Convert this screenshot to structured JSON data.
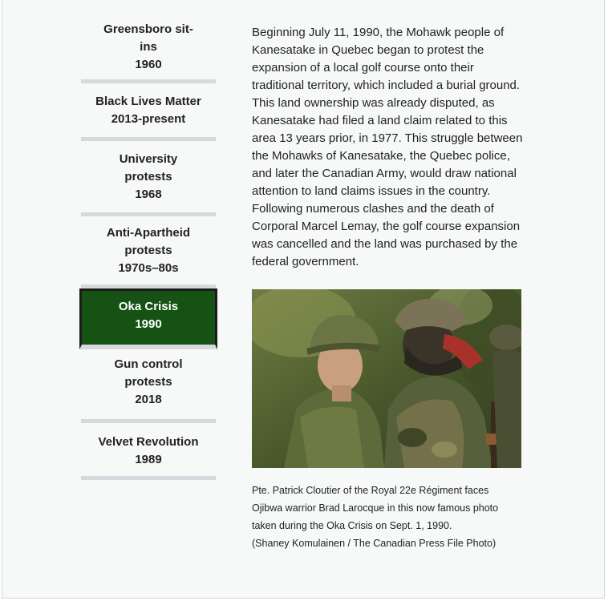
{
  "tabs": [
    {
      "title": "Greensboro sit-ins",
      "year": "1960",
      "active": false
    },
    {
      "title": "Black Lives Matter",
      "year": "2013-present",
      "active": false
    },
    {
      "title": "University protests",
      "year": "1968",
      "active": false
    },
    {
      "title": "Anti-Apartheid protests",
      "year": "1970s–80s",
      "active": false
    },
    {
      "title": "Oka Crisis",
      "year": "1990",
      "active": true
    },
    {
      "title": "Gun control protests",
      "year": "2018",
      "active": false
    },
    {
      "title": "Velvet Revolution",
      "year": "1989",
      "active": false
    }
  ],
  "content": {
    "paragraph": "Beginning July 11, 1990, the Mohawk people of Kanesatake in Quebec began to protest the expansion of a local golf course onto their traditional territory, which included a burial ground. This land ownership was already disputed, as Kanesatake had filed a land claim related to this area 13 years prior, in 1977. This struggle between the Mohawks of Kanesatake, the Quebec police, and later the Canadian Army, would draw national attention to land claims issues in the country. Following numerous clashes and the death of Corporal Marcel Lemay, the golf course expansion was cancelled and the land was purchased by the federal government.",
    "caption_line1": "Pte. Patrick Cloutier of the Royal 22e Régiment faces",
    "caption_line2": "Ojibwa warrior Brad Larocque in this now famous photo",
    "caption_line3": "taken during the Oka Crisis on Sept. 1, 1990.",
    "caption_credit": "(Shaney Komulainen / The Canadian Press File Photo)"
  },
  "colors": {
    "active_tab_bg": "#155214",
    "tab_divider": "#d6dade",
    "panel_bg": "#f7f8f8"
  }
}
